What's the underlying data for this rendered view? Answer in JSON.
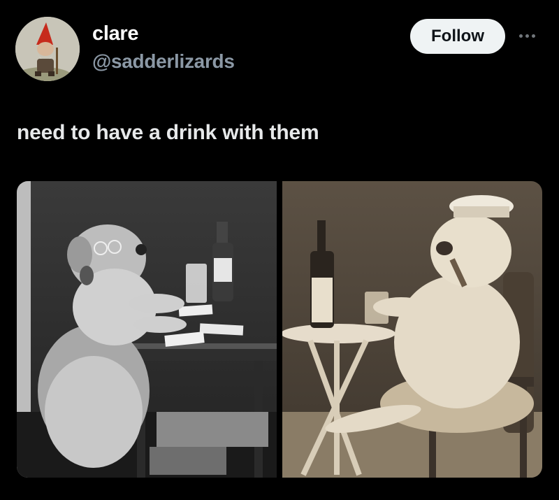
{
  "user": {
    "display_name": "clare",
    "handle": "@sadderlizards",
    "avatar_icon": "gnome-avatar"
  },
  "actions": {
    "follow_label": "Follow",
    "more_icon": "more-horizontal-icon"
  },
  "tweet": {
    "text": "need to have a drink with them"
  },
  "media": {
    "photos": [
      {
        "description_icon": "dog-playing-cards-photo"
      },
      {
        "description_icon": "dog-sailor-with-cigar-photo"
      }
    ]
  },
  "colors": {
    "background": "#000000",
    "text_primary": "#e7e9ea",
    "text_secondary": "#8b98a5",
    "follow_bg": "#eff3f4",
    "follow_text": "#0f1419"
  }
}
